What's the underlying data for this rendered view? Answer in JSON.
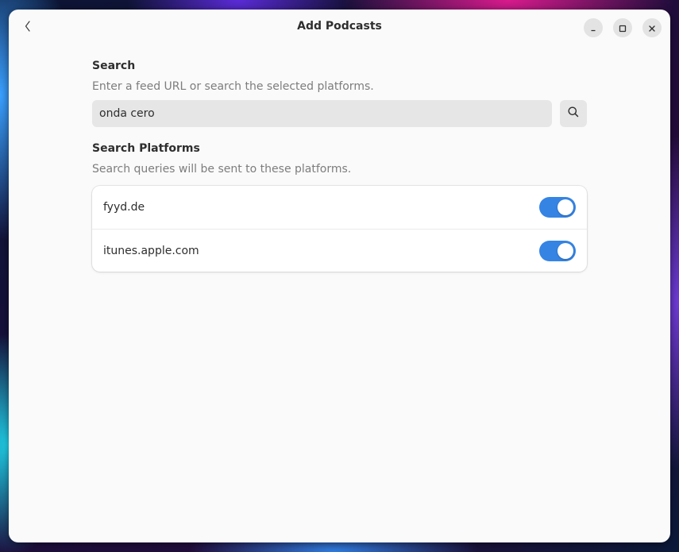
{
  "window": {
    "title": "Add Podcasts"
  },
  "header": {
    "back_icon": "chevron-left-icon",
    "minimize_icon": "minimize-icon",
    "maximize_icon": "maximize-icon",
    "close_icon": "close-icon"
  },
  "search": {
    "heading": "Search",
    "description": "Enter a feed URL or search the selected platforms.",
    "value": "onda cero",
    "button_icon": "search-icon"
  },
  "platforms": {
    "heading": "Search Platforms",
    "description": "Search queries will be sent to these platforms.",
    "items": [
      {
        "label": "fyyd.de",
        "enabled": true
      },
      {
        "label": "itunes.apple.com",
        "enabled": true
      }
    ]
  },
  "colors": {
    "accent": "#3584e4",
    "window_bg": "#fafafa",
    "input_bg": "#e6e6e6"
  }
}
